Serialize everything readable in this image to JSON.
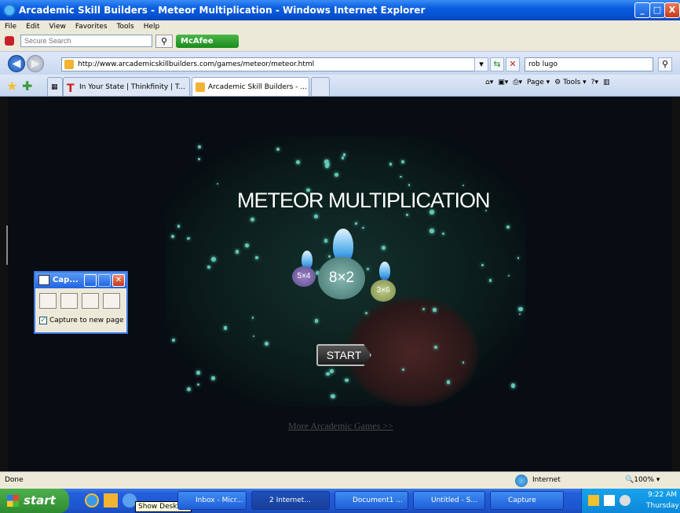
{
  "window": {
    "title": "Arcademic Skill Builders - Meteor Multiplication - Windows Internet Explorer",
    "min_label": "_",
    "max_label": "□",
    "close_label": "X"
  },
  "menu": [
    "File",
    "Edit",
    "View",
    "Favorites",
    "Tools",
    "Help"
  ],
  "searchbar": {
    "placeholder": "Secure Search",
    "mcafee_label": "McAfee"
  },
  "address": {
    "url": "http://www.arcademicskillbuilders.com/games/meteor/meteor.html",
    "live_search": "rob lugo"
  },
  "tabs": [
    {
      "label": "In Your State | Thinkfinity | T..."
    },
    {
      "label": "Arcademic Skill Builders - ...",
      "active": true
    }
  ],
  "toolbar": {
    "page_label": "Page",
    "tools_label": "Tools"
  },
  "game": {
    "title": "METEOR MULTIPLICATION",
    "meteors": [
      {
        "label": "5×4",
        "color": "#7a5fa8"
      },
      {
        "label": "8×2",
        "color": "#5e9a94"
      },
      {
        "label": "3×6",
        "color": "#9fae6a"
      }
    ],
    "start_label": "START",
    "more_link": "More Arcademic Games >>"
  },
  "capture_window": {
    "title": "Cap...",
    "checkbox_label": "Capture to new page",
    "checked": true
  },
  "status": {
    "left": "Done",
    "zone": "Internet",
    "zoom": "100%"
  },
  "taskbar": {
    "start_label": "start",
    "tooltip": "Show Desktop",
    "items": [
      {
        "label": "Inbox - Micr..."
      },
      {
        "label": "2 Internet..."
      },
      {
        "label": "Document1 ..."
      },
      {
        "label": "Untitled - S..."
      },
      {
        "label": "Capture"
      }
    ],
    "time": "9:22 AM",
    "day": "Thursday"
  }
}
